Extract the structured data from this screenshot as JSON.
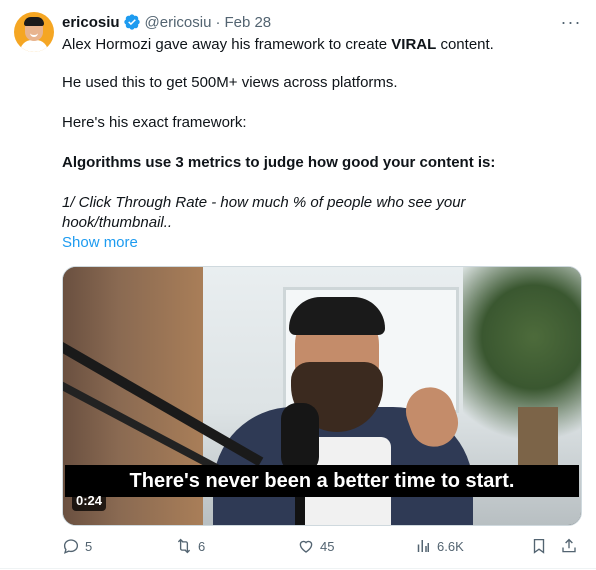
{
  "tweet": {
    "author": {
      "name": "ericosiu",
      "handle": "@ericosiu",
      "separator": "·",
      "date": "Feb 28",
      "verified": true
    },
    "more_label": "···",
    "text": {
      "line1_prefix": "Alex Hormozi gave away his framework to create ",
      "line1_bold": "VIRAL",
      "line1_suffix": " content.",
      "line2": "He used this to get 500M+ views across platforms.",
      "line3": "Here's his exact framework:",
      "line4": "Algorithms use 3 metrics to judge how good your content is:",
      "line5": "1/ Click Through Rate - how much % of people who see your",
      "line6": "hook/thumbnail..",
      "show_more": "Show more"
    },
    "media": {
      "caption": "There's never been a better time to start.",
      "duration": "0:24"
    },
    "actions": {
      "reply_count": "5",
      "retweet_count": "6",
      "like_count": "45",
      "views_count": "6.6K"
    },
    "icons": {
      "verified": "verified-badge-icon",
      "reply": "reply-icon",
      "retweet": "retweet-icon",
      "like": "heart-icon",
      "views": "views-icon",
      "bookmark": "bookmark-icon",
      "share": "share-icon"
    },
    "colors": {
      "accent": "#1d9bf0",
      "text": "#0f1419",
      "muted": "#536471"
    }
  }
}
